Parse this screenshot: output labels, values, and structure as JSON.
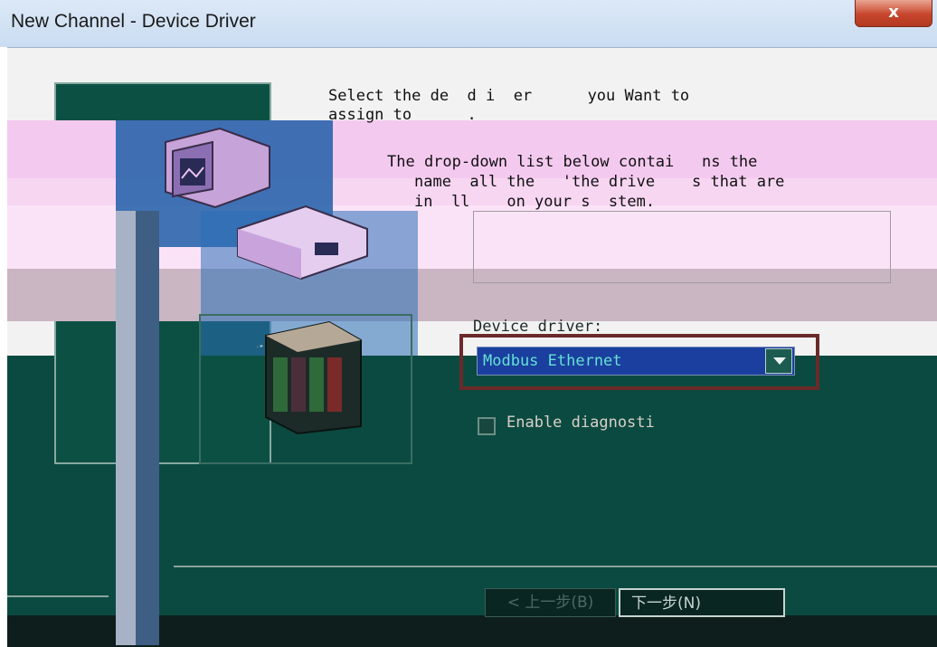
{
  "window": {
    "title": "New Channel - Device Driver",
    "close_label": "x"
  },
  "instructions": {
    "line1": "Select the de  d i  er      you Want to",
    "line2": "assign to      .  ",
    "line3": "The drop-down list below contai   ns the",
    "line4": "name  all the   'the drive    s that are",
    "line5": "in  ll    on your s  stem."
  },
  "driver": {
    "label": "Device driver:",
    "value": "Modbus Ethernet"
  },
  "diagnostics": {
    "label": "Enable diagnosti",
    "checked": false
  },
  "buttons": {
    "back": "< 上一步(B)",
    "next": "下一步(N)"
  },
  "icons": {
    "close": "close-icon",
    "dropdown": "chevron-down-icon",
    "pc": "computer-icon",
    "plc": "plc-device-icon"
  }
}
